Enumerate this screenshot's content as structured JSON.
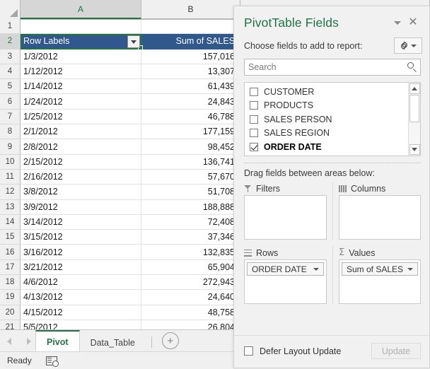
{
  "grid": {
    "column_headers": [
      "A",
      "B"
    ],
    "selected_column": "A",
    "selected_row": "2",
    "row_numbers": [
      "1",
      "2",
      "3",
      "4",
      "5",
      "6",
      "7",
      "8",
      "9",
      "10",
      "11",
      "12",
      "13",
      "14",
      "15",
      "16",
      "17",
      "18",
      "19",
      "20",
      "21"
    ],
    "pivot_header": {
      "row_labels": "Row Labels",
      "value_header": "Sum of SALES"
    },
    "rows": [
      {
        "label": "1/3/2012",
        "value": "157,016"
      },
      {
        "label": "1/12/2012",
        "value": "13,307"
      },
      {
        "label": "1/14/2012",
        "value": "61,439"
      },
      {
        "label": "1/24/2012",
        "value": "24,843"
      },
      {
        "label": "1/25/2012",
        "value": "46,788"
      },
      {
        "label": "2/1/2012",
        "value": "177,159"
      },
      {
        "label": "2/8/2012",
        "value": "98,452"
      },
      {
        "label": "2/15/2012",
        "value": "136,741"
      },
      {
        "label": "2/16/2012",
        "value": "57,670"
      },
      {
        "label": "3/8/2012",
        "value": "51,708"
      },
      {
        "label": "3/9/2012",
        "value": "188,888"
      },
      {
        "label": "3/14/2012",
        "value": "72,408"
      },
      {
        "label": "3/15/2012",
        "value": "37,346"
      },
      {
        "label": "3/16/2012",
        "value": "132,835"
      },
      {
        "label": "3/21/2012",
        "value": "65,904"
      },
      {
        "label": "4/6/2012",
        "value": "272,943"
      },
      {
        "label": "4/13/2012",
        "value": "24,640"
      },
      {
        "label": "4/15/2012",
        "value": "48,758"
      },
      {
        "label": "5/5/2012",
        "value": "26,804"
      }
    ]
  },
  "tabs": {
    "items": [
      {
        "label": "Pivot",
        "active": true
      },
      {
        "label": "Data_Table",
        "active": false
      }
    ],
    "add_sheet": "+"
  },
  "status": {
    "text": "Ready"
  },
  "panel": {
    "title": "PivotTable Fields",
    "choose_label": "Choose fields to add to report:",
    "search": {
      "placeholder": "Search",
      "value": ""
    },
    "fields": [
      {
        "name": "CUSTOMER",
        "checked": false
      },
      {
        "name": "PRODUCTS",
        "checked": false
      },
      {
        "name": "SALES PERSON",
        "checked": false
      },
      {
        "name": "SALES REGION",
        "checked": false
      },
      {
        "name": "ORDER DATE",
        "checked": true
      }
    ],
    "drag_label": "Drag fields between areas below:",
    "areas": {
      "filters": {
        "label": "Filters",
        "items": []
      },
      "columns": {
        "label": "Columns",
        "items": []
      },
      "rows": {
        "label": "Rows",
        "items": [
          "ORDER DATE"
        ]
      },
      "values": {
        "label": "Values",
        "items": [
          "Sum of SALES"
        ]
      }
    },
    "defer_label": "Defer Layout Update",
    "update_label": "Update"
  },
  "colors": {
    "excel_green": "#217346",
    "pivot_header_blue": "#30588c",
    "panel_bg": "#f1f1f1"
  }
}
